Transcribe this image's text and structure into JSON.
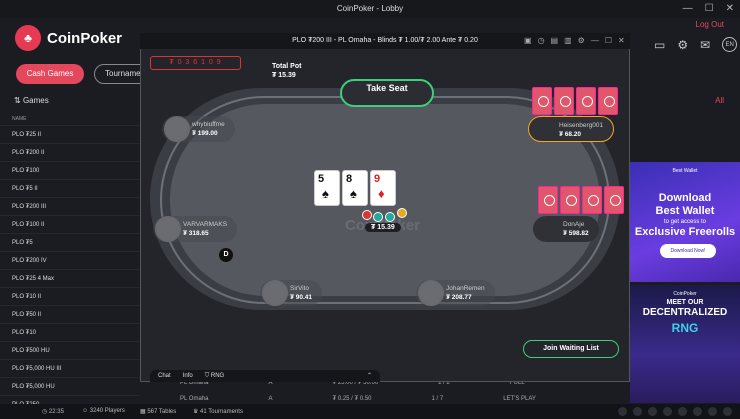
{
  "window": {
    "title": "CoinPoker - Lobby"
  },
  "header": {
    "brand": "CoinPoker",
    "logout": "Log Out",
    "lang": "EN",
    "logo_glyph": "♣"
  },
  "tabs": {
    "cash": "Cash Games",
    "tournaments": "Tournaments"
  },
  "games_label": "Games",
  "all_label": "All",
  "lobby": {
    "col_name": "NAME",
    "rows": [
      "PLO ₮25 II",
      "PLO ₮200 II",
      "PLO ₮100",
      "PLO ₮5 II",
      "PLO ₮200 III",
      "PLO ₮100 II",
      "PLO ₮5",
      "PLO ₮200 IV",
      "PLO ₮25 4 Max",
      "PLO ₮10 II",
      "PLO ₮50 II",
      "PLO ₮10",
      "PLO ₮500 HU",
      "PLO ₮5,000 HU III",
      "PLO ₮5,000 HU",
      "PLO ₮250"
    ]
  },
  "bg_rows": [
    {
      "type": "PL Omaha",
      "marker": "A",
      "stakes": "₮ 25.00 / ₮ 50.00",
      "players": "2 / 2",
      "btn": "FULL"
    },
    {
      "type": "PL Omaha",
      "marker": "A",
      "stakes": "₮ 0.25 / ₮ 0.50",
      "players": "1 / 7",
      "btn": "LET'S PLAY"
    }
  ],
  "footer": {
    "time": "22:35",
    "players": "3240 Players",
    "tables": "567 Tables",
    "tournaments": "41 Tournaments"
  },
  "game": {
    "title": "PLO ₮200 III - PL Omaha - Blinds ₮ 1.00/₮ 2.00 Ante ₮ 0.20",
    "hand_id": "₮ 0 3 6 1 0 9",
    "total_pot_label": "Total Pot",
    "total_pot": "₮ 15.39",
    "take_seat": "Take Seat",
    "watermark": "CoinPoker",
    "pot_chip": "₮ 15.39",
    "board": [
      {
        "rank": "5",
        "suit": "♠",
        "color": "black"
      },
      {
        "rank": "8",
        "suit": "♠",
        "color": "black"
      },
      {
        "rank": "9",
        "suit": "♦",
        "color": "red"
      }
    ],
    "dealer": "D",
    "waitlist": "Join Waiting List",
    "bottom_tabs": [
      "Chat",
      "Info",
      "RNG"
    ],
    "seats": [
      {
        "name": "whybluffme",
        "stack": "₮ 199.00"
      },
      {
        "name": "Heisenberg001",
        "stack": "₮ 68.20"
      },
      {
        "name": "VARVARMAKS",
        "stack": "₮ 318.65"
      },
      {
        "name": "DonAje",
        "stack": "₮ 598.82"
      },
      {
        "name": "SirVito",
        "stack": "₮ 90.41"
      },
      {
        "name": "JohanRemen",
        "stack": "₮ 208.77"
      }
    ]
  },
  "ads": {
    "ad1": {
      "brand": "Best Wallet",
      "line1": "Download",
      "line2": "Best Wallet",
      "line3": "to get access to",
      "line4": "Exclusive Freerolls",
      "cta": "Download Now!"
    },
    "ad2": {
      "brand": "CoinPoker",
      "line1": "MEET OUR",
      "line2": "DECENTRALIZED",
      "line3": "RNG"
    }
  },
  "colors": {
    "accent": "#e5475d",
    "green": "#3cd07a",
    "hero_ring": "#f5a623"
  }
}
